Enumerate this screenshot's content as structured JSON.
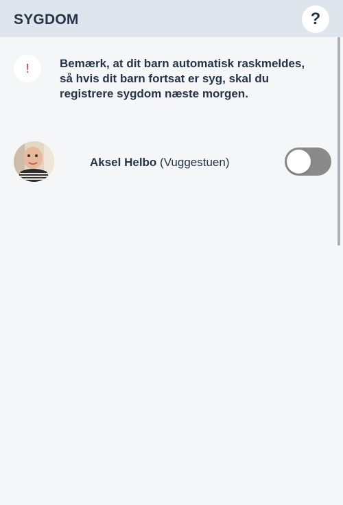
{
  "header": {
    "title": "SYGDOM",
    "help_label": "?"
  },
  "notice": {
    "icon": "exclamation-icon",
    "icon_glyph": "!",
    "text": "Bemærk, at dit barn automatisk raskmeldes, så hvis dit barn fortsat er syg, skal du registrere sygdom næste morgen."
  },
  "children": [
    {
      "first_name": "Aksel Helbo",
      "group": "(Vuggestuen)",
      "sick": false
    }
  ],
  "colors": {
    "header_bg": "#dfe5ec",
    "page_bg": "#f4f6f8",
    "text": "#263446",
    "notice_accent": "#c0334f",
    "toggle_off": "#8a8a8a"
  }
}
